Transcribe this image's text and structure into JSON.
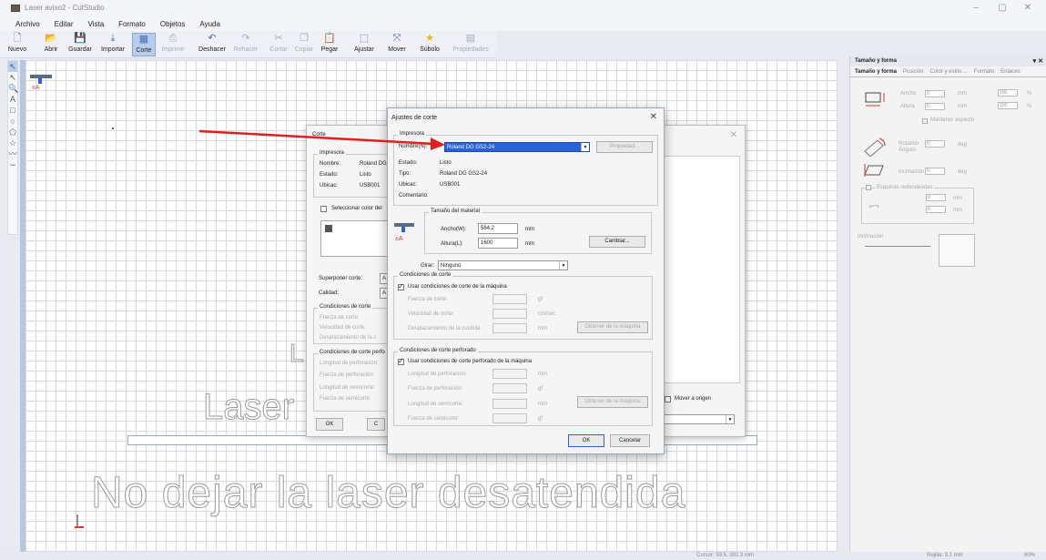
{
  "window": {
    "title": "Laser aviso2 - CutStudio",
    "controls": [
      "–",
      "▢",
      "✕"
    ]
  },
  "menu": [
    "Archivo",
    "Editar",
    "Vista",
    "Formato",
    "Objetos",
    "Ayuda"
  ],
  "toolbar": [
    {
      "label": "Nuevo",
      "icon": "new-icon",
      "glyph": "🗋",
      "disabled": false
    },
    {
      "label": "Abrir",
      "icon": "open-icon",
      "glyph": "📂",
      "disabled": false
    },
    {
      "label": "Guardar",
      "icon": "save-icon",
      "glyph": "💾",
      "disabled": false
    },
    {
      "label": "Importar",
      "icon": "import-icon",
      "glyph": "⤓",
      "disabled": false
    },
    {
      "label": "Corte",
      "icon": "cut-icon",
      "glyph": "▦",
      "disabled": false,
      "active": true
    },
    {
      "label": "Imprimir",
      "icon": "print-icon",
      "glyph": "⎙",
      "disabled": true
    },
    {
      "label": "Deshacer",
      "icon": "undo-icon",
      "glyph": "↶",
      "disabled": false
    },
    {
      "label": "Rehacer",
      "icon": "redo-icon",
      "glyph": "↷",
      "disabled": true
    },
    {
      "label": "Cortar",
      "icon": "cut-scissors-icon",
      "glyph": "✂",
      "disabled": true
    },
    {
      "label": "Copiar",
      "icon": "copy-icon",
      "glyph": "❐",
      "disabled": true
    },
    {
      "label": "Pegar",
      "icon": "paste-icon",
      "glyph": "📋",
      "disabled": false
    },
    {
      "label": "Ajustar",
      "icon": "fit-icon",
      "glyph": "⬚",
      "disabled": false
    },
    {
      "label": "Mover",
      "icon": "move-icon",
      "glyph": "⤧",
      "disabled": false
    },
    {
      "label": "Súbolo",
      "icon": "star-icon",
      "glyph": "★",
      "disabled": false
    },
    {
      "label": "Propiedades",
      "icon": "properties-icon",
      "glyph": "▤",
      "disabled": true
    }
  ],
  "left_tools": [
    "↖",
    "↖",
    "🔍",
    "A",
    "□",
    "○",
    "⬠",
    "☆",
    "〰",
    "∼"
  ],
  "canvas": {
    "big_text": "No dejar la laser desatendida",
    "laser_text": "Laser",
    "partial_letter": "L"
  },
  "back_dialog": {
    "title": "Corte",
    "printer_group": "Impresora",
    "nombre_label": "Nombre:",
    "nombre_value": "Roland DG",
    "estado_label": "Estado:",
    "estado_value": "Listo",
    "ubicac_label": "Ubicac:",
    "ubicac_value": "USB001",
    "select_color_label": "Seleccionar color del",
    "superponer_label": "Superponer corte:",
    "superponer_value": "A",
    "calidad_label": "Calidad:",
    "calidad_value": "A",
    "cond_group": "Condiciones de corte",
    "cond_items": [
      "Fuerza de corte:",
      "Velocidad de corte:",
      "Desplazamiento de la c"
    ],
    "perf_group": "Condiciones de corte perfo",
    "perf_items": [
      "Longitud de perforación:",
      "Fuerza de perforación:",
      "Longitud de semicorte:",
      "Fuerza de semicorte:"
    ],
    "ok": "OK",
    "cancel_partial": "C",
    "mover_origen": "Mover a origen"
  },
  "dialog": {
    "title": "Ajustes de corte",
    "printer_group": "Impresora",
    "nombre_label": "Nombre(N):",
    "nombre_value": "Roland DG GS2-24",
    "propiedad_button": "Propiedad...",
    "estado_label": "Estado:",
    "estado_value": "Listo",
    "tipo_label": "Tipo:",
    "tipo_value": "Roland DG GS2-24",
    "ubicac_label": "Ubicac:",
    "ubicac_value": "USB001",
    "comentario_label": "Comentario:",
    "material_group": "Tamaño del material",
    "ancho_label": "Ancho(W):",
    "ancho_value": "584.2",
    "altura_label": "Altura(L):",
    "altura_value": "1600",
    "unit_mm": "mm",
    "cambiar_button": "Cambiar...",
    "girar_label": "Girar:",
    "girar_value": "Ninguno",
    "cond_group": "Condiciones de corte",
    "cond_checkbox": "Usar condiciones de corte de la máquina",
    "fuerza_label": "Fuerza de corte:",
    "fuerza_unit": "gf",
    "velocidad_label": "Velocidad de corte:",
    "velocidad_unit": "cm/sec",
    "desplaz_label": "Desplazamiento de la cuchilla:",
    "desplaz_unit": "mm",
    "obtener_button": "Obtener de la máquina",
    "perf_group": "Condiciones de corte perforado",
    "perf_checkbox": "Usar condiciones de corte perforado de la máquina",
    "long_perf_label": "Longitud de perforación:",
    "long_perf_unit": "mm",
    "fuerza_perf_label": "Fuerza de perforación:",
    "fuerza_perf_unit": "gf",
    "long_semi_label": "Longitud de semicorte:",
    "long_semi_unit": "mm",
    "fuerza_semi_label": "Fuerza de semicorte:",
    "fuerza_semi_unit": "gf",
    "obtener2_button": "Obtener de la máquina",
    "ok": "OK",
    "cancel": "Cancelar"
  },
  "right_panel": {
    "title": "Tamaño y forma",
    "tabs": [
      "Tamaño y forma",
      "Posición",
      "Color y estilo ...",
      "Formato",
      "Enlaces"
    ],
    "ancho_label": "Ancho",
    "ancho_value": "0",
    "ancho_pct": "100",
    "altura_label": "Altura",
    "altura_value": "0",
    "altura_pct": "100",
    "unit": "mm",
    "pct_unit": "%",
    "mantener": "Mantener aspecto",
    "rotation_label": "Rotation Ángulo",
    "rotation_value": "0",
    "deg": "deg",
    "inclinacion_label": "Inclinación",
    "inclinacion_value": "0",
    "esquinas_label": "Esquinas redondeadas",
    "esq_v1": "0",
    "esq_v2": "0",
    "inclinacion2": "Inclinación"
  },
  "status": {
    "cursor": "Cursor: 59.5, 392.3 mm",
    "rejilla": "Rejilla: 3.1 mm",
    "zoom": "60%"
  },
  "colors": {
    "arrow": "#e02020",
    "selection": "#2a62d8",
    "active_tool": "#b6cdee"
  }
}
